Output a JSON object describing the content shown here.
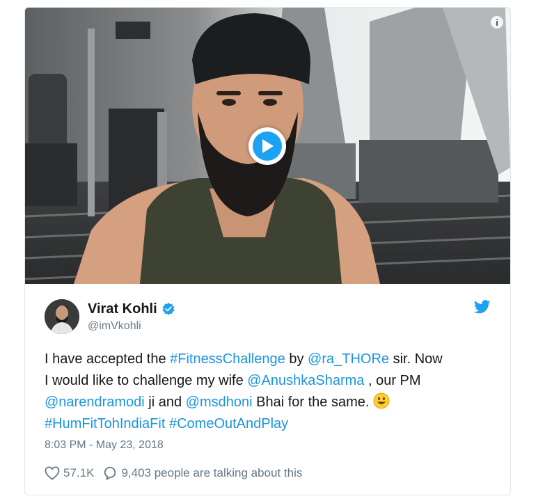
{
  "media": {
    "info_icon_label": "i",
    "play_icon": "play-icon"
  },
  "author": {
    "display_name": "Virat Kohli",
    "handle": "@imVkohli",
    "verified_icon": "verified-badge-icon"
  },
  "tweet": {
    "line1": [
      {
        "text": "I have accepted the ",
        "link": false
      },
      {
        "text": "#FitnessChallenge",
        "link": true
      },
      {
        "text": " by ",
        "link": false
      },
      {
        "text": "@ra_THORe",
        "link": true
      },
      {
        "text": " sir. Now",
        "link": false
      }
    ],
    "line2": [
      {
        "text": "I would like to challenge my wife ",
        "link": false
      },
      {
        "text": "@AnushkaSharma",
        "link": true
      },
      {
        "text": " , our PM",
        "link": false
      }
    ],
    "line3": [
      {
        "text": "@narendramodi",
        "link": true
      },
      {
        "text": " ji and ",
        "link": false
      },
      {
        "text": "@msdhoni",
        "link": true
      },
      {
        "text": " Bhai for the same. ",
        "link": false
      }
    ],
    "line4": [
      {
        "text": "#HumFitTohIndiaFit",
        "link": true
      },
      {
        "text": " ",
        "link": false
      },
      {
        "text": "#ComeOutAndPlay",
        "link": true
      }
    ],
    "emoji": "grinning-face-emoji",
    "timestamp": "8:03 PM - May 23, 2018"
  },
  "actions": {
    "likes": "57.1K",
    "talking": "9,403 people are talking about this"
  },
  "colors": {
    "link": "#1b95e0",
    "twitter_blue": "#1da1f2",
    "muted": "#657786"
  }
}
